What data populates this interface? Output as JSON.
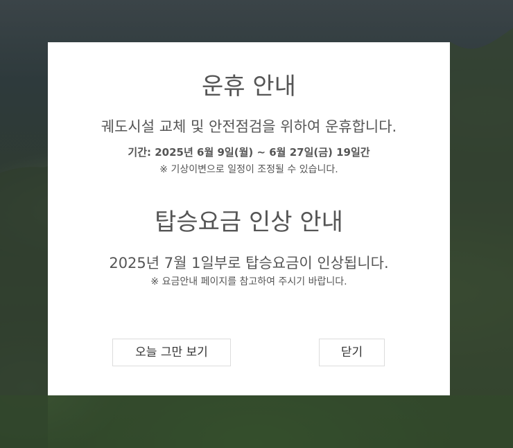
{
  "notice1": {
    "title": "운휴 안내",
    "description": "궤도시설 교체 및 안전점검을 위하여 운휴합니다.",
    "period": "기간: 2025년 6월 9일(월) ~ 6월 27일(금) 19일간",
    "note": "※ 기상이변으로 일정이 조정될 수 있습니다."
  },
  "notice2": {
    "title": "탑승요금 인상 안내",
    "description": "2025년 7월 1일부로 탑승요금이 인상됩니다.",
    "note": "※ 요금안내 페이지를 참고하여 주시기 바랍니다."
  },
  "buttons": {
    "hide_today": "오늘 그만 보기",
    "close": "닫기"
  },
  "colors": {
    "modal_bg": "#ffffff",
    "text": "#555555",
    "button_border": "#dcdcdc"
  }
}
